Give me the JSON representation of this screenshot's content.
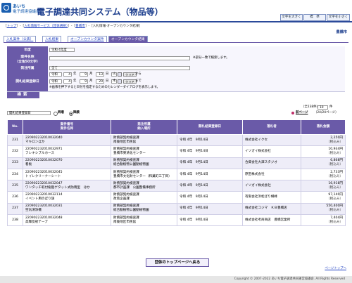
{
  "header": {
    "logo_line1": "あいち",
    "logo_line2": "電子調達協議会",
    "system_title": "電子調達共同システム（物品等）",
    "btn_font_large": "文字を大きく",
    "btn_font_standard": "標　準",
    "btn_font_small": "文字を小さく"
  },
  "breadcrumb": {
    "top": "トップ",
    "service": "入札情報サービス（団体選択）",
    "org": "豊橋市",
    "current": "入札情報-オープンカウンタ結果"
  },
  "org_name": "豊橋市",
  "tabs": [
    {
      "label": "入札案件（公表）"
    },
    {
      "label": "入札結果"
    },
    {
      "label": "オープンカウンタ案件"
    },
    {
      "label": "オープンカウンタ結果"
    }
  ],
  "form": {
    "fiscal_year_label": "年度",
    "fiscal_year_value": "令和 4年度",
    "case_name_label": "案件名称\n（全角50文字）",
    "case_name_note": "※部分一致で検索します。",
    "dept_label": "発注所属",
    "dept_value": "全て",
    "date_label": "開札結果登録日",
    "from_era": "令和",
    "from_y": "4",
    "from_m": "9",
    "from_d": "13",
    "from_dow": "火",
    "to_era": "令和",
    "to_y": "4",
    "to_m": "9",
    "to_d": "29",
    "to_dow": "木",
    "unit_year": "年",
    "unit_month": "月",
    "unit_day": "日",
    "clear_label": "クリア",
    "from_suffix": "から",
    "to_suffix": "まで",
    "calendar_note": "※画像を押下すると日付を指定するためのカレンダーダイアログを表示します。",
    "search_label": "検索"
  },
  "controls": {
    "sort_value": "開札結果登録日",
    "asc_label": "昇順",
    "desc_label": "降順",
    "total": "（全238件）",
    "per_page": "10",
    "per_page_unit": "件",
    "prev_page": "前ページ",
    "page_indicator": "（24/24ページ）"
  },
  "table": {
    "headers": [
      "No.",
      "案件番号\n案件名称",
      "発注所属\n納入場所",
      "開札結果登録日",
      "落札者",
      "落札金額"
    ],
    "rows": [
      {
        "no": "231",
        "num": "220902232010032040",
        "name": "マキロンほか",
        "dept": "財務部契約検査課",
        "place": "南陵地区市民館",
        "date": "令和 4年　9月14日",
        "winner": "株式会社イクセ",
        "amount": "2,250円",
        "tax": "（税込み）"
      },
      {
        "no": "232",
        "num": "220902232010032971",
        "name": "フレキシブルホース",
        "dept": "財務部契約検査課",
        "place": "豊橋市東清化センター",
        "date": "令和 4年　9月14日",
        "winner": "イソガイ株式会社",
        "amount": "10,934円",
        "tax": "（税込み）"
      },
      {
        "no": "233",
        "num": "220902232010032070",
        "name": "看板",
        "dept": "財務部契約検査課",
        "place": "総合動植物公園動植物園",
        "date": "令和 4年　9月14日",
        "winner": "合資会社大澤スタジオ",
        "amount": "6,868円",
        "tax": "（税込み）"
      },
      {
        "no": "234",
        "num": "220902232010032045",
        "name": "トイレクリーナーシート",
        "dept": "財務部契約検査課",
        "place": "豊橋市文化財センター（和菓町三丁目）",
        "date": "令和 4年　9月14日",
        "winner": "原田株式会社",
        "amount": "2,733円",
        "tax": "（税込み）"
      },
      {
        "no": "235",
        "num": "220902232010032047",
        "name": "ワンタッチ取付樹脂ゲタット式防雨型　ほか",
        "dept": "財務部契約検査課",
        "place": "都市計画課　公園整備事務所",
        "date": "令和 4年　9月14日",
        "winner": "イソガイ株式会社",
        "amount": "16,918円",
        "tax": "（税込み）"
      },
      {
        "no": "236",
        "num": "220902232010032114",
        "name": "イベント用のぼり旗",
        "dept": "財務部契約検査課",
        "place": "政策企画課",
        "date": "令和 4年　9月14日",
        "winner": "有限会社浜松ぼり幟峰",
        "amount": "97,140円",
        "tax": "（税込み）"
      },
      {
        "no": "237",
        "num": "220902232010032031",
        "name": "空気清浄機",
        "dept": "財務部契約検査課",
        "place": "総合動植物公園動植物園",
        "date": "令和 4年　9月14日",
        "winner": "株式会社コジマ　ＫＢ豊橋店",
        "amount": "550,400円",
        "tax": "（税込み）"
      },
      {
        "no": "238",
        "num": "220902232010032048",
        "name": "高輝反射テープ",
        "dept": "財務部契約検査課",
        "place": "南陵地区市民館",
        "date": "令和 4年　9月14日",
        "winner": "株式会社考商商店　豊橋営業所",
        "amount": "7,404円",
        "tax": "（税込み）"
      }
    ]
  },
  "back_button": "団体のトップページへ戻る",
  "page_top": "ページトップへ",
  "footer": "Copyright © 2007-2022 あいち電子調達共同運営協議会. All Rights Reserved"
}
